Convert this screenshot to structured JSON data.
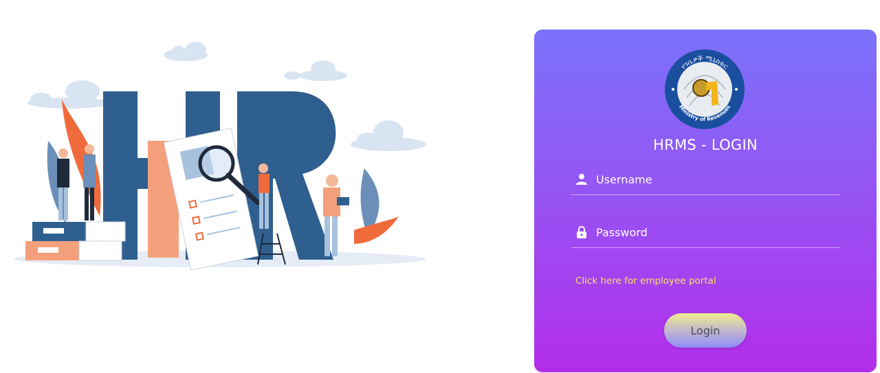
{
  "illustration": {
    "letters": "HR"
  },
  "logo": {
    "top_text": "የገቢዎች ሚኒስቴር",
    "bottom_text": "Ministry of Revenues"
  },
  "login": {
    "title": "HRMS - LOGIN",
    "username_placeholder": "Username",
    "password_placeholder": "Password",
    "portal_link": "Click here for employee portal",
    "button_label": "Login"
  },
  "colors": {
    "card_top": "#7b72fb",
    "card_bottom": "#b32ee9",
    "link": "#f5e267",
    "hr_letters": "#2f5f8f",
    "accent_orange": "#f07a4a"
  },
  "icons": {
    "username": "user-icon",
    "password": "lock-icon"
  }
}
